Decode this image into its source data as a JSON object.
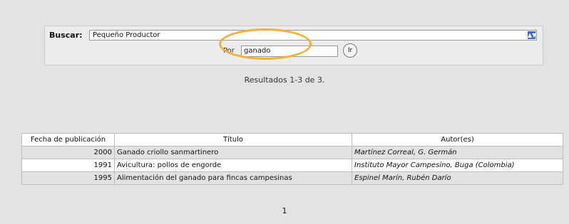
{
  "search": {
    "buscar_label": "Buscar:",
    "collection_value": "Pequeño Productor",
    "por_label": "Por",
    "query_value": "ganado",
    "go_label": "Ir",
    "highlight_color": "#f2b233"
  },
  "results": {
    "summary": "Resultados 1-3 de 3.",
    "columns": [
      "Fecha de publicación",
      "Título",
      "Autor(es)"
    ],
    "rows": [
      {
        "date": "2000",
        "title": "Ganado criollo sanmartinero",
        "author": "Martínez Correal, G. Germán"
      },
      {
        "date": "1991",
        "title": "Avicultura: pollos de engorde",
        "author": "Instituto Mayor Campesino, Buga (Colombia)"
      },
      {
        "date": "1995",
        "title": "Alimentación del ganado para fincas campesinas",
        "author": "Espinel Marín, Rubén Darío"
      }
    ]
  },
  "pager": {
    "page": "1"
  }
}
